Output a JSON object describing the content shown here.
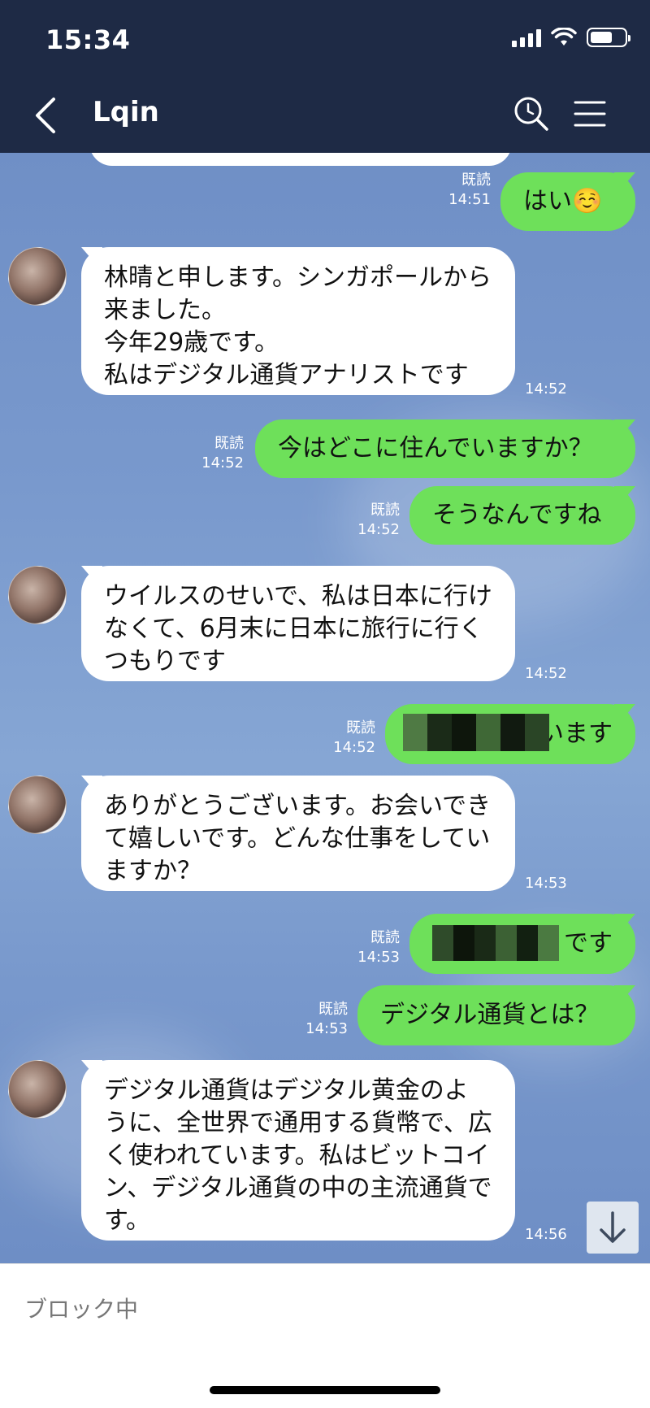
{
  "status_bar": {
    "time": "15:34"
  },
  "header": {
    "title": "Lqin"
  },
  "messages": [
    {
      "type": "out",
      "text": "はい☺️",
      "read": "既読",
      "time": "14:51"
    },
    {
      "type": "in",
      "text": "林晴と申します。シンガポールから来ました。\n今年29歳です。\n私はデジタル通貨アナリストです",
      "time": "14:52"
    },
    {
      "type": "out",
      "text": "今はどこに住んでいますか？",
      "read": "既読",
      "time": "14:52"
    },
    {
      "type": "out",
      "text": "そうなんですね",
      "read": "既読",
      "time": "14:52"
    },
    {
      "type": "in",
      "text": "ウイルスのせいで、私は日本に行けなくて、6月末に日本に旅行に行くつもりです",
      "time": "14:52"
    },
    {
      "type": "out",
      "text": "います",
      "read": "既読",
      "time": "14:52"
    },
    {
      "type": "in",
      "text": "ありがとうございます。お会いできて嬉しいです。どんな仕事をしていますか？",
      "time": "14:53"
    },
    {
      "type": "out",
      "text": "です",
      "read": "既読",
      "time": "14:53"
    },
    {
      "type": "out",
      "text": "デジタル通貨とは？",
      "read": "既読",
      "time": "14:53"
    },
    {
      "type": "in",
      "text": "デジタル通貨はデジタル黄金のように、全世界で通用する貨幣で、広く使われています。私はビットコイン、デジタル通貨の中の主流通貨です。",
      "time": "14:56"
    }
  ],
  "footer": {
    "status": "ブロック中"
  },
  "colors": {
    "header_bg": "#1e2a45",
    "out_bubble": "#6ee05a",
    "in_bubble": "#ffffff"
  },
  "icons": [
    "back-icon",
    "search-icon",
    "menu-icon",
    "arrow-down-icon",
    "wifi-icon",
    "signal-icon",
    "battery-icon"
  ]
}
